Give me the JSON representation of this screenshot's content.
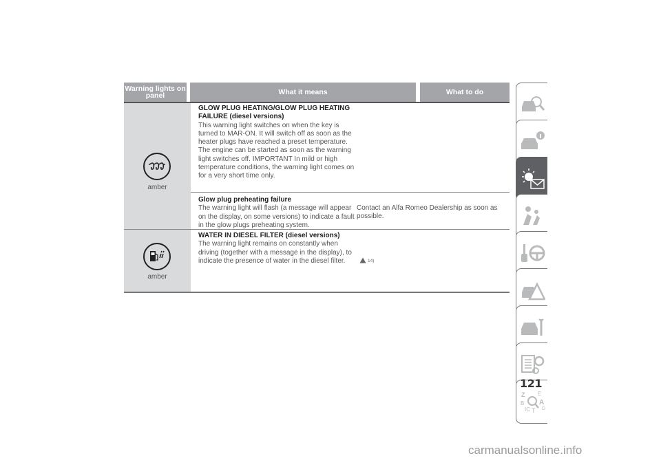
{
  "table": {
    "headers": [
      "Warning lights on panel",
      "What it means",
      "What to do"
    ],
    "rows": [
      {
        "lamp": {
          "icon": "glow-plug-icon",
          "color_label": "amber"
        },
        "entries": [
          {
            "title": "GLOW PLUG HEATING/GLOW PLUG HEATING FAILURE (diesel versions)",
            "text": "This warning light switches on when the key is turned to MAR-ON. It will switch off as soon as the heater plugs have reached a preset temperature. The engine can be started as soon as the warning light switches off. IMPORTANT In mild or high temperature conditions, the warning light comes on for a very short time only.",
            "todo": ""
          },
          {
            "title": "Glow plug preheating failure",
            "text": "The warning light will flash (a message will appear on the display, on some versions) to indicate a fault in the glow plugs preheating system.",
            "todo": "Contact an Alfa Romeo Dealership as soon as possible."
          }
        ]
      },
      {
        "lamp": {
          "icon": "water-in-diesel-filter-icon",
          "color_label": "amber"
        },
        "entries": [
          {
            "title": "WATER IN DIESEL FILTER (diesel versions)",
            "text": "The warning light remains on constantly when driving (together with a message in the display), to indicate the presence of water in the diesel filter.",
            "todo": "",
            "note": {
              "icon": "warning-triangle-icon",
              "ref": "14)"
            }
          }
        ]
      }
    ]
  },
  "side_tabs": [
    {
      "icon": "car-search-icon",
      "active": false
    },
    {
      "icon": "car-info-icon",
      "active": false
    },
    {
      "icon": "warning-light-message-icon",
      "active": true
    },
    {
      "icon": "airbag-passenger-icon",
      "active": false
    },
    {
      "icon": "key-steering-wheel-icon",
      "active": false
    },
    {
      "icon": "car-warning-triangle-icon",
      "active": false
    },
    {
      "icon": "car-wrench-icon",
      "active": false
    },
    {
      "icon": "specs-gear-icon",
      "active": false
    },
    {
      "icon": "alphabetical-index-icon",
      "active": false
    }
  ],
  "page_number": "121",
  "watermark": "carmanualsonline.info"
}
